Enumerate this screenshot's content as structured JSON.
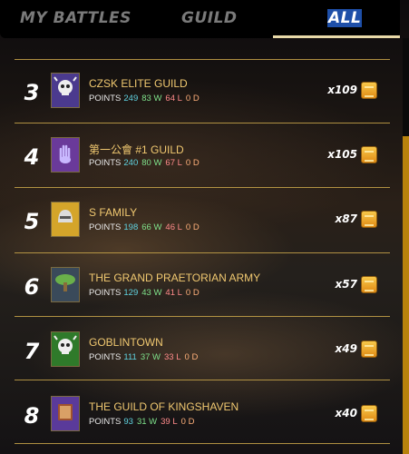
{
  "tabs": {
    "battles": "MY BATTLES",
    "guild": "GUILD",
    "all": "ALL"
  },
  "points_label": "POINTS",
  "rows": [
    {
      "rank": "3",
      "name": "CZSK ELITE GUILD",
      "points": "249",
      "w": "83 W",
      "l": "64 L",
      "d": "0 D",
      "reward": "x109",
      "banner_icon": "skull-icon",
      "banner_color": "#4b3a8e"
    },
    {
      "rank": "4",
      "name": "第一公會 #1 GUILD",
      "points": "240",
      "w": "80 W",
      "l": "67 L",
      "d": "0 D",
      "reward": "x105",
      "banner_icon": "hand-icon",
      "banner_color": "#6a3a9a"
    },
    {
      "rank": "5",
      "name": "S FAMILY",
      "points": "198",
      "w": "66 W",
      "l": "46 L",
      "d": "0 D",
      "reward": "x87",
      "banner_icon": "helmet-icon",
      "banner_color": "#d4a52a"
    },
    {
      "rank": "6",
      "name": "THE GRAND PRAETORIAN ARMY",
      "points": "129",
      "w": "43 W",
      "l": "41 L",
      "d": "0 D",
      "reward": "x57",
      "banner_icon": "tree-icon",
      "banner_color": "#3a4a5a"
    },
    {
      "rank": "7",
      "name": "GOBLINTOWN",
      "points": "111",
      "w": "37 W",
      "l": "33 L",
      "d": "0 D",
      "reward": "x49",
      "banner_icon": "skull-icon",
      "banner_color": "#2f7a2a"
    },
    {
      "rank": "8",
      "name": "THE GUILD OF KINGSHAVEN",
      "points": "93",
      "w": "31 W",
      "l": "39 L",
      "d": "0 D",
      "reward": "x40",
      "banner_icon": "book-icon",
      "banner_color": "#5a3a9a"
    }
  ]
}
